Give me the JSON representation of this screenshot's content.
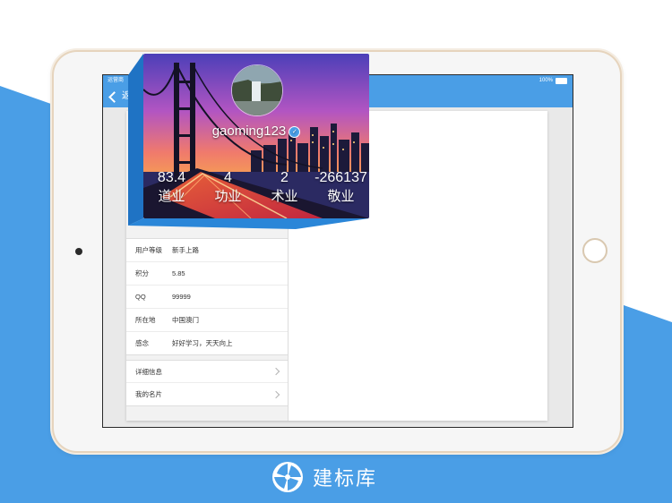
{
  "colors": {
    "brand_blue": "#4a9ee6",
    "ipad_bezel": "#f6f6f6",
    "ipad_trim": "#e6d4bd"
  },
  "status_bar": {
    "carrier": "运营商",
    "battery": "100%"
  },
  "nav": {
    "back_label": "返回"
  },
  "profile": {
    "username": "gaoming123",
    "badge_icon": "verified-badge-icon",
    "stats": [
      {
        "value": "83.4",
        "label": "道业"
      },
      {
        "value": "4",
        "label": "功业"
      },
      {
        "value": "2",
        "label": "术业"
      },
      {
        "value": "-266137",
        "label": "敬业"
      }
    ]
  },
  "info_rows": [
    {
      "label": "用户等级",
      "value": "新手上路"
    },
    {
      "label": "积分",
      "value": "5.85"
    },
    {
      "label": "QQ",
      "value": "99999"
    },
    {
      "label": "所在地",
      "value": "中国澳门"
    },
    {
      "label": "感念",
      "value": "好好学习，天天向上"
    }
  ],
  "nav_rows": [
    {
      "label": "详细信息"
    },
    {
      "label": "我的名片"
    }
  ],
  "brand": {
    "name": "建标库",
    "logo_icon": "jianbiaoku-logo-icon"
  }
}
